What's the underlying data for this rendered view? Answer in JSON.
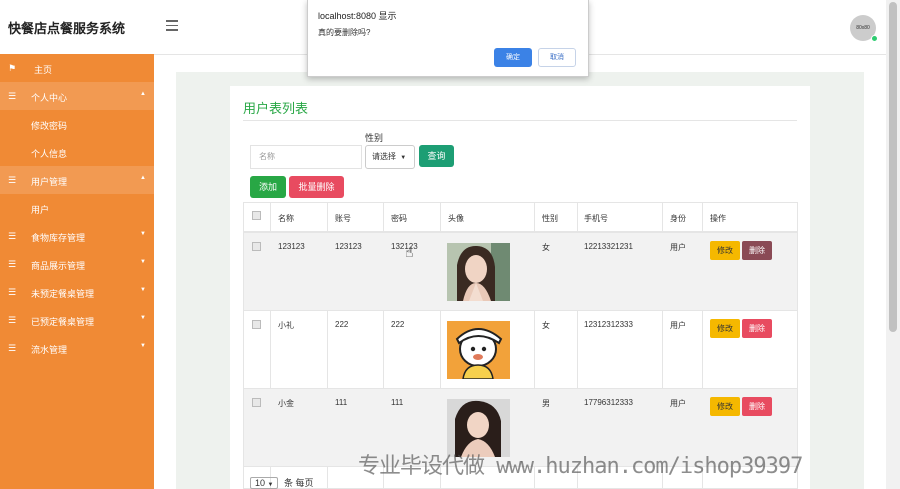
{
  "app": {
    "title": "快餐店点餐服务系统",
    "avatar_text": "80x80"
  },
  "sidebar": {
    "items": [
      {
        "label": "主页",
        "icon": "flag-icon",
        "expandable": false,
        "indent": false
      },
      {
        "label": "个人中心",
        "icon": "list-icon",
        "expandable": true,
        "indent": false,
        "active": true
      },
      {
        "label": "修改密码",
        "icon": "",
        "expandable": false,
        "indent": true
      },
      {
        "label": "个人信息",
        "icon": "",
        "expandable": false,
        "indent": true
      },
      {
        "label": "用户管理",
        "icon": "list-icon",
        "expandable": true,
        "indent": false,
        "active": true
      },
      {
        "label": "用户",
        "icon": "",
        "expandable": false,
        "indent": true
      },
      {
        "label": "食物库存管理",
        "icon": "list-icon",
        "expandable": true,
        "indent": false
      },
      {
        "label": "商品展示管理",
        "icon": "list-icon",
        "expandable": true,
        "indent": false
      },
      {
        "label": "未预定餐桌管理",
        "icon": "list-icon",
        "expandable": true,
        "indent": false
      },
      {
        "label": "已预定餐桌管理",
        "icon": "list-icon",
        "expandable": true,
        "indent": false
      },
      {
        "label": "流水管理",
        "icon": "list-icon",
        "expandable": true,
        "indent": false
      }
    ]
  },
  "page": {
    "title": "用户表列表",
    "search": {
      "name_placeholder": "名称",
      "gender_label": "性别",
      "gender_value": "请选择",
      "query_label": "查询"
    },
    "add_label": "添加",
    "batch_delete_label": "批量删除",
    "columns": [
      "名称",
      "账号",
      "密码",
      "头像",
      "性别",
      "手机号",
      "身份",
      "操作"
    ],
    "rows": [
      {
        "name": "123123",
        "account": "123123",
        "password": "132123",
        "gender": "女",
        "phone": "12213321231",
        "role": "用户",
        "avatar": "woman-portrait"
      },
      {
        "name": "小礼",
        "account": "222",
        "password": "222",
        "gender": "女",
        "phone": "12312312333",
        "role": "用户",
        "avatar": "cartoon-character"
      },
      {
        "name": "小金",
        "account": "111",
        "password": "111",
        "gender": "男",
        "phone": "17796312333",
        "role": "用户",
        "avatar": "woman-portrait"
      }
    ],
    "edit_label": "修改",
    "delete_label": "删除",
    "pager": {
      "page_size": "10",
      "suffix": "条 每页"
    }
  },
  "dialog": {
    "title": "localhost:8080 显示",
    "message": "真的要删除吗?",
    "ok_label": "确定",
    "cancel_label": "取消"
  },
  "watermark": "专业毕设代做 www.huzhan.com/ishop39397",
  "colors": {
    "sidebar": "#f08a35",
    "primary_green": "#28a745",
    "danger": "#e84b60",
    "warning": "#f5b800",
    "dialog_ok": "#3b82e6"
  }
}
